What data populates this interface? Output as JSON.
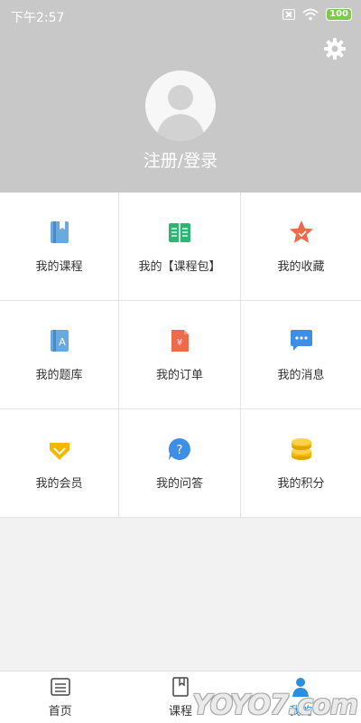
{
  "status_bar": {
    "time": "下午2:57",
    "battery": "100"
  },
  "header": {
    "login_text": "注册/登录"
  },
  "menu": {
    "items": [
      {
        "label": "我的课程",
        "icon": "course-book-icon"
      },
      {
        "label": "我的【课程包】",
        "icon": "open-book-icon"
      },
      {
        "label": "我的收藏",
        "icon": "star-icon"
      },
      {
        "label": "我的题库",
        "icon": "question-bank-icon"
      },
      {
        "label": "我的订单",
        "icon": "order-icon"
      },
      {
        "label": "我的消息",
        "icon": "message-icon"
      },
      {
        "label": "我的会员",
        "icon": "vip-gem-icon"
      },
      {
        "label": "我的问答",
        "icon": "question-bubble-icon"
      },
      {
        "label": "我的积分",
        "icon": "coins-icon"
      }
    ]
  },
  "tabs": [
    {
      "label": "首页",
      "icon": "home-list-icon"
    },
    {
      "label": "课程",
      "icon": "course-icon"
    },
    {
      "label": "我的",
      "icon": "user-icon",
      "active": true
    }
  ],
  "watermark": "YOYO7.com",
  "colors": {
    "header_bg": "#c8c8c8",
    "active_tab": "#2a8fde",
    "battery": "#7ec850"
  }
}
